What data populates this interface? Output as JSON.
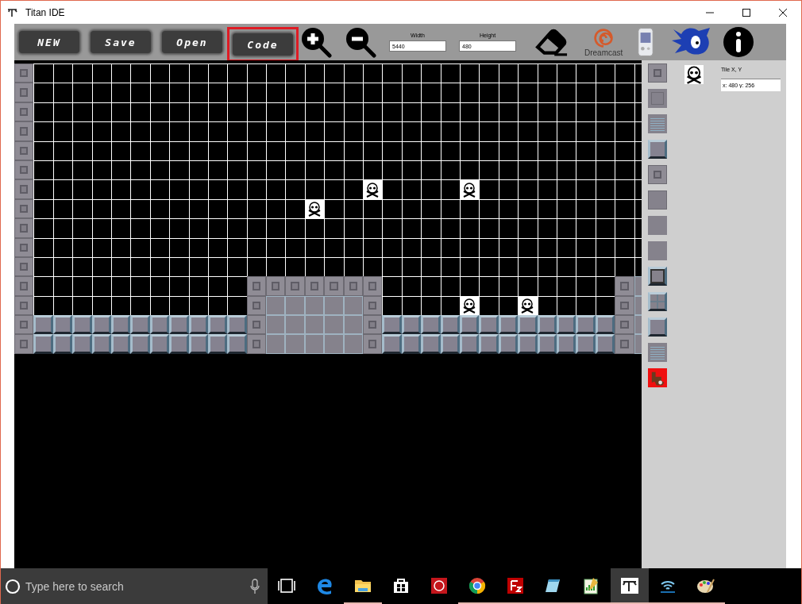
{
  "window": {
    "title": "Titan IDE"
  },
  "toolbar": {
    "buttons": [
      {
        "label": "NEW",
        "highlighted": false
      },
      {
        "label": "Save",
        "highlighted": false
      },
      {
        "label": "Open",
        "highlighted": false
      },
      {
        "label": "Code",
        "highlighted": true
      }
    ],
    "width_field": {
      "label": "Width",
      "value": "5440"
    },
    "height_field": {
      "label": "Height",
      "value": "480"
    },
    "console_logo": {
      "label": "Dreamcast"
    }
  },
  "tile_palette": [
    {
      "kind": "cross"
    },
    {
      "kind": "frame"
    },
    {
      "kind": "vent"
    },
    {
      "kind": "block"
    },
    {
      "kind": "cross"
    },
    {
      "kind": "riveted"
    },
    {
      "kind": "plain"
    },
    {
      "kind": "plain"
    },
    {
      "kind": "frame-block"
    },
    {
      "kind": "grid-block"
    },
    {
      "kind": "block"
    },
    {
      "kind": "vent"
    },
    {
      "kind": "sprite"
    }
  ],
  "tile_info": {
    "label": "Tile X, Y",
    "value": "x: 480 y: 256"
  },
  "taskbar": {
    "search": {
      "placeholder": "Type here to search"
    },
    "apps": [
      {
        "kind": "edge",
        "running": false,
        "selected": false
      },
      {
        "kind": "folder",
        "running": true,
        "selected": false
      },
      {
        "kind": "store",
        "running": false,
        "selected": false
      },
      {
        "kind": "music",
        "running": false,
        "selected": false
      },
      {
        "kind": "chrome",
        "running": true,
        "selected": false
      },
      {
        "kind": "ftp",
        "running": true,
        "selected": false
      },
      {
        "kind": "notepad",
        "running": true,
        "selected": false
      },
      {
        "kind": "chart",
        "running": true,
        "selected": false
      },
      {
        "kind": "titan",
        "running": true,
        "selected": true
      },
      {
        "kind": "wifi",
        "running": true,
        "selected": false
      },
      {
        "kind": "paint",
        "running": true,
        "selected": false
      }
    ]
  }
}
